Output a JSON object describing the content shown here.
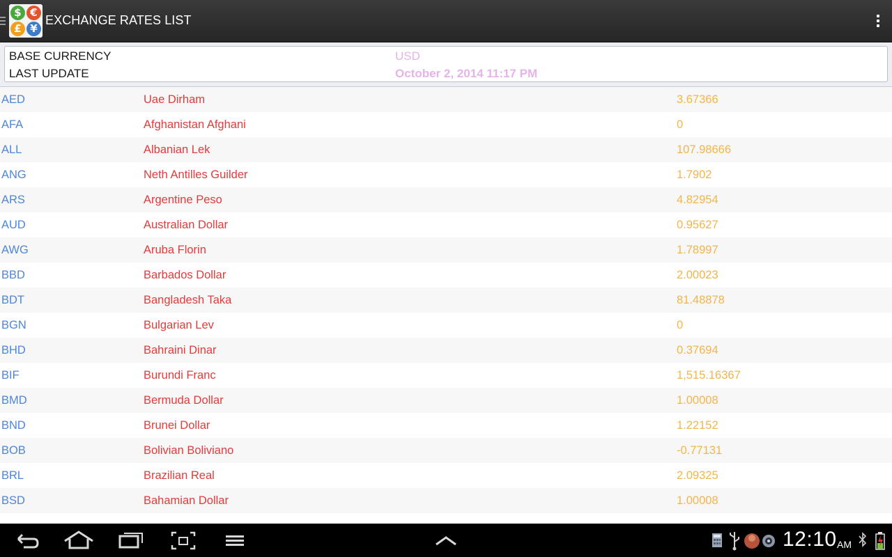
{
  "app": {
    "title": "EXCHANGE RATES LIST",
    "icon": "currency-coins-icon",
    "coins": [
      {
        "symbol": "$",
        "color": "#4aa83c"
      },
      {
        "symbol": "€",
        "color": "#e3542c"
      },
      {
        "symbol": "£",
        "color": "#f0a020"
      },
      {
        "symbol": "¥",
        "color": "#3d7cc9"
      }
    ]
  },
  "info": {
    "base_label": "BASE CURRENCY",
    "base_value": "USD",
    "update_label": "LAST UPDATE",
    "update_value": "October 2, 2014 11:17 PM"
  },
  "colors": {
    "code": "#4f86d6",
    "name": "#e23b3b",
    "rate": "#f2b54a",
    "info_value": "#e6b3ea"
  },
  "rates": [
    {
      "code": "AED",
      "name": "Uae Dirham",
      "rate": "3.67366"
    },
    {
      "code": "AFA",
      "name": "Afghanistan Afghani",
      "rate": "0"
    },
    {
      "code": "ALL",
      "name": "Albanian Lek",
      "rate": "107.98666"
    },
    {
      "code": "ANG",
      "name": "Neth Antilles Guilder",
      "rate": "1.7902"
    },
    {
      "code": "ARS",
      "name": "Argentine Peso",
      "rate": "4.82954"
    },
    {
      "code": "AUD",
      "name": "Australian Dollar",
      "rate": "0.95627"
    },
    {
      "code": "AWG",
      "name": "Aruba Florin",
      "rate": "1.78997"
    },
    {
      "code": "BBD",
      "name": "Barbados Dollar",
      "rate": "2.00023"
    },
    {
      "code": "BDT",
      "name": "Bangladesh Taka",
      "rate": "81.48878"
    },
    {
      "code": "BGN",
      "name": "Bulgarian Lev",
      "rate": "0"
    },
    {
      "code": "BHD",
      "name": "Bahraini Dinar",
      "rate": "0.37694"
    },
    {
      "code": "BIF",
      "name": "Burundi Franc",
      "rate": "1,515.16367"
    },
    {
      "code": "BMD",
      "name": "Bermuda Dollar",
      "rate": "1.00008"
    },
    {
      "code": "BND",
      "name": "Brunei Dollar",
      "rate": "1.22152"
    },
    {
      "code": "BOB",
      "name": "Bolivian Boliviano",
      "rate": "-0.77131"
    },
    {
      "code": "BRL",
      "name": "Brazilian Real",
      "rate": "2.09325"
    },
    {
      "code": "BSD",
      "name": "Bahamian Dollar",
      "rate": "1.00008"
    }
  ],
  "navbar": {
    "buttons": [
      "back-icon",
      "home-icon",
      "recent-apps-icon",
      "screenshot-icon",
      "menu-icon",
      "up-chevron-icon"
    ],
    "status_icons": [
      "calculator-icon",
      "usb-icon",
      "avatar-icon",
      "camera-icon",
      "bluetooth-icon",
      "battery-icon"
    ],
    "time": "12:10",
    "ampm": "AM"
  }
}
